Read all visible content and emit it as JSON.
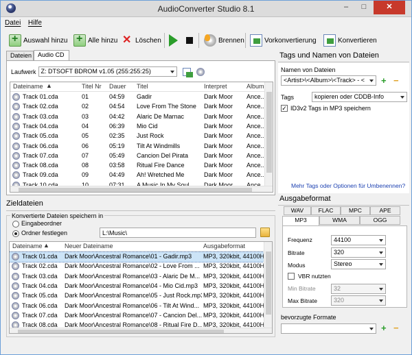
{
  "window": {
    "title": "AudioConverter Studio 8.1",
    "min": "–",
    "max": "□",
    "close": "✕"
  },
  "menu": [
    "Datei",
    "Hilfe"
  ],
  "toolbar": {
    "add_selection": "Auswahl hinzu",
    "add_all": "Alle hinzu",
    "delete": "Löschen",
    "burn": "Brennen",
    "preconvert": "Vorkonvertierung",
    "convert": "Konvertieren"
  },
  "source_tabs": [
    "Dateien",
    "Audio CD"
  ],
  "drive": {
    "label": "Laufwerk",
    "value": "Z: DTSOFT BDROM v1.05 (255:255:25)"
  },
  "tracks": {
    "headers": [
      "Dateiname",
      "Titel Nr",
      "Dauer",
      "Titel",
      "Interpret",
      "Album"
    ],
    "rows": [
      [
        "Track 01.cda",
        "01",
        "04:59",
        "Gadir",
        "Dark Moor",
        "Ance..."
      ],
      [
        "Track 02.cda",
        "02",
        "04:54",
        "Love From The Stone",
        "Dark Moor",
        "Ance..."
      ],
      [
        "Track 03.cda",
        "03",
        "04:42",
        "Alaric De Marnac",
        "Dark Moor",
        "Ance..."
      ],
      [
        "Track 04.cda",
        "04",
        "06:39",
        "Mio Cid",
        "Dark Moor",
        "Ance..."
      ],
      [
        "Track 05.cda",
        "05",
        "02:35",
        "Just Rock",
        "Dark Moor",
        "Ance..."
      ],
      [
        "Track 06.cda",
        "06",
        "05:19",
        "Tilt At Windmills",
        "Dark Moor",
        "Ance..."
      ],
      [
        "Track 07.cda",
        "07",
        "05:49",
        "Cancion Del Pirata",
        "Dark Moor",
        "Ance..."
      ],
      [
        "Track 08.cda",
        "08",
        "03:58",
        "Ritual Fire Dance",
        "Dark Moor",
        "Ance..."
      ],
      [
        "Track 09.cda",
        "09",
        "04:49",
        "Ah! Wretched Me",
        "Dark Moor",
        "Ance..."
      ],
      [
        "Track 10.cda",
        "10",
        "07:31",
        "A Music In My Soul",
        "Dark Moor",
        "Ance..."
      ]
    ]
  },
  "target": {
    "title": "Zieldateien",
    "group_label": "Konvertierte Dateien speichern in",
    "radio_source": "Eingabeordner",
    "radio_fixed": "Ordner festlegen",
    "folder": "L:\\Music\\",
    "headers": [
      "Dateiname",
      "Neuer Dateiname",
      "Ausgabeformat"
    ],
    "rows": [
      [
        "Track 01.cda",
        "Dark Moor\\Ancestral Romance\\01 - Gadir.mp3",
        "MP3, 320kbit, 44100Hz"
      ],
      [
        "Track 02.cda",
        "Dark Moor\\Ancestral Romance\\02 - Love From ...",
        "MP3, 320kbit, 44100Hz"
      ],
      [
        "Track 03.cda",
        "Dark Moor\\Ancestral Romance\\03 - Alaric De M...",
        "MP3, 320kbit, 44100Hz"
      ],
      [
        "Track 04.cda",
        "Dark Moor\\Ancestral Romance\\04 - Mio Cid.mp3",
        "MP3, 320kbit, 44100Hz"
      ],
      [
        "Track 05.cda",
        "Dark Moor\\Ancestral Romance\\05 - Just Rock.mp3",
        "MP3, 320kbit, 44100Hz"
      ],
      [
        "Track 06.cda",
        "Dark Moor\\Ancestral Romance\\06 - Tilt At Wind...",
        "MP3, 320kbit, 44100Hz"
      ],
      [
        "Track 07.cda",
        "Dark Moor\\Ancestral Romance\\07 - Cancion Del...",
        "MP3, 320kbit, 44100Hz"
      ],
      [
        "Track 08.cda",
        "Dark Moor\\Ancestral Romance\\08 - Ritual Fire D...",
        "MP3, 320kbit, 44100Hz"
      ]
    ]
  },
  "tags": {
    "title": "Tags und Namen von Dateien",
    "names_label": "Namen von Dateien",
    "names_value": "<Artist>\\<Album>\\<Track> - <",
    "tags_label": "Tags",
    "tags_value": "kopieren oder CDDB-Info",
    "id3_label": "ID3v2 Tags in MP3 speichern",
    "more_link": "Mehr Tags oder Optionen für Umbenennen?"
  },
  "output": {
    "title": "Ausgabeformat",
    "tabs_row1": [
      "WAV",
      "FLAC",
      "MPC",
      "APE"
    ],
    "tabs_row2": [
      "MP3",
      "WMA",
      "OGG"
    ],
    "frequency_label": "Frequenz",
    "frequency": "44100",
    "bitrate_label": "Bitrate",
    "bitrate": "320",
    "mode_label": "Modus",
    "mode": "Stereo",
    "vbr_label": "VBR nutzten",
    "min_label": "Min Bitrate",
    "min": "32",
    "max_label": "Max Bitrate",
    "max": "320",
    "preferred_label": "bevorzugte Formate"
  },
  "colors": {
    "accent_blue": "#1a3fb0",
    "selected_row": "#cce4f7",
    "close_red": "#c7392b"
  }
}
